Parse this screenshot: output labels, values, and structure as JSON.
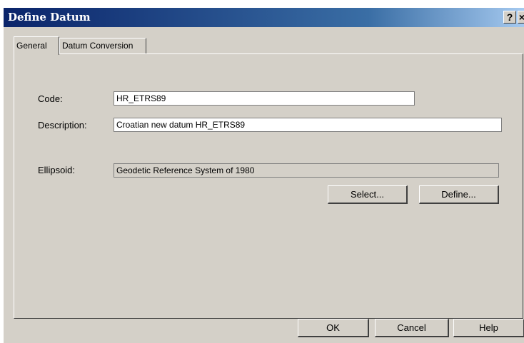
{
  "window": {
    "title": "Define Datum",
    "help_glyph": "?",
    "close_glyph": "×"
  },
  "tabs": [
    {
      "label": "General",
      "active": true
    },
    {
      "label": "Datum Conversion",
      "active": false
    }
  ],
  "form": {
    "code_label": "Code:",
    "code_value": "HR_ETRS89",
    "description_label": "Description:",
    "description_value": "Croatian new datum HR_ETRS89",
    "ellipsoid_label": "Ellipsoid:",
    "ellipsoid_value": "Geodetic Reference System of 1980",
    "select_label": "Select...",
    "define_label": "Define..."
  },
  "footer": {
    "ok_label": "OK",
    "cancel_label": "Cancel",
    "help_label": "Help"
  }
}
